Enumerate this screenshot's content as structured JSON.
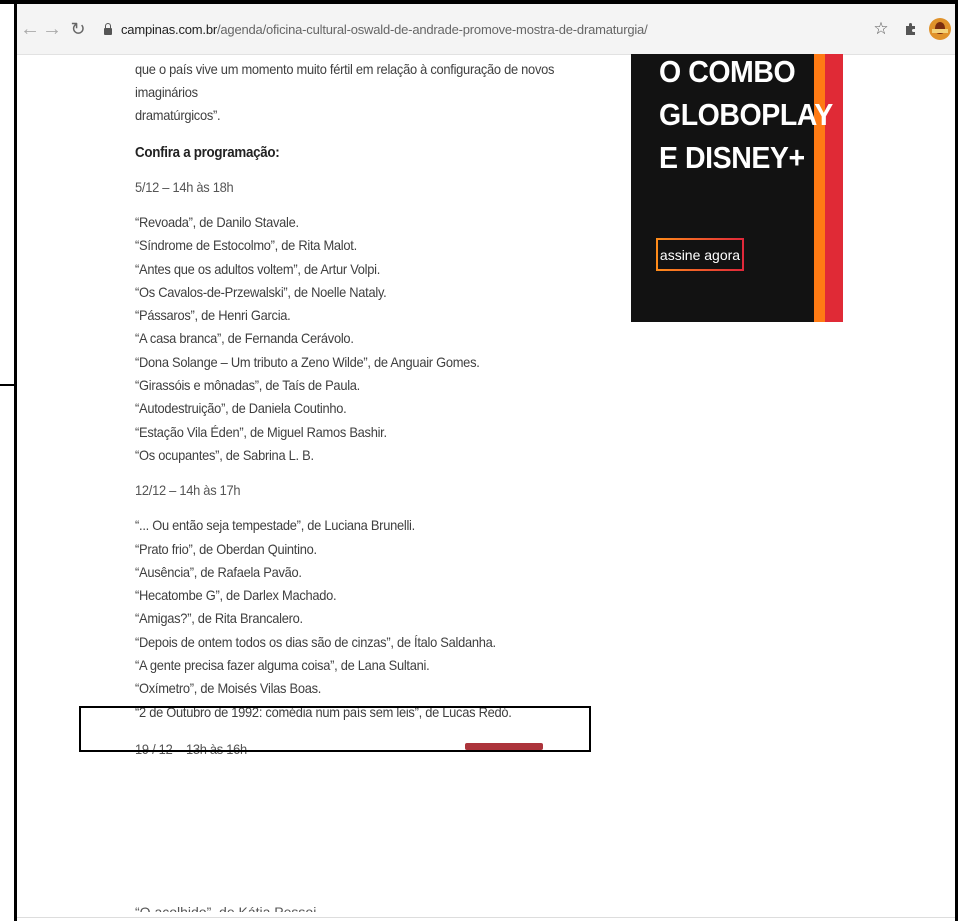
{
  "browser": {
    "url_host": "campinas.com.br",
    "url_path": "/agenda/oficina-cultural-oswald-de-andrade-promove-mostra-de-dramaturgia/",
    "back_icon": "back-arrow-icon",
    "forward_icon": "forward-arrow-icon",
    "reload_icon": "reload-icon",
    "bookmark_icon": "star-icon",
    "extensions_icon": "puzzle-icon"
  },
  "article": {
    "intro_line1": "que o país vive um momento muito fértil em relação à configuração de novos imaginários",
    "intro_line2": "dramatúrgicos”.",
    "heading": "Confira a programação:",
    "sessions": [
      {
        "date": "5/12 – 14h às 18h",
        "items": [
          "“Revoada”, de Danilo Stavale.",
          "“Síndrome de Estocolmo”, de Rita Malot.",
          "“Antes que os adultos voltem”, de Artur Volpi.",
          "“Os Cavalos-de-Przewalski”, de Noelle Nataly.",
          "“Pássaros”, de Henri Garcia.",
          "“A casa branca”, de Fernanda Cerávolo.",
          "“Dona Solange – Um tributo a Zeno Wilde”, de Anguair Gomes.",
          "“Girassóis e mônadas”, de Taís de Paula.",
          "“Autodestruição”, de Daniela Coutinho.",
          "“Estação Vila Éden”, de Miguel Ramos Bashir.",
          "“Os ocupantes”, de Sabrina L. B."
        ]
      },
      {
        "date": "12/12 – 14h às 17h",
        "items": [
          "“... Ou então seja tempestade”, de Luciana Brunelli.",
          "“Prato frio”, de Oberdan Quintino.",
          "“Ausência”, de Rafaela Pavão.",
          "“Hecatombe G”, de Darlex Machado.",
          "“Amigas?”, de Rita Brancalero.",
          "“Depois de ontem todos os dias são de cinzas”, de Ítalo Saldanha.",
          "“A gente precisa fazer alguma coisa”, de Lana Sultani.",
          "“Oxímetro”, de Moisés Vilas Boas.",
          "“2 de Outubro de 1992: comédia num país sem leis”, de Lucas Redó."
        ]
      },
      {
        "date": "19 / 12 – 13h às 16h",
        "items": []
      }
    ],
    "cutoff_line": "“O acolhido”, de Kátia Pessoi"
  },
  "ad": {
    "headline_line1": "O COMBO",
    "headline_line2": "GLOBOPLAY",
    "headline_line3": "E DISNEY+",
    "cta": "assine agora",
    "colors": {
      "background": "#121212",
      "orange": "#ff7a14",
      "red": "#e02a36"
    }
  }
}
